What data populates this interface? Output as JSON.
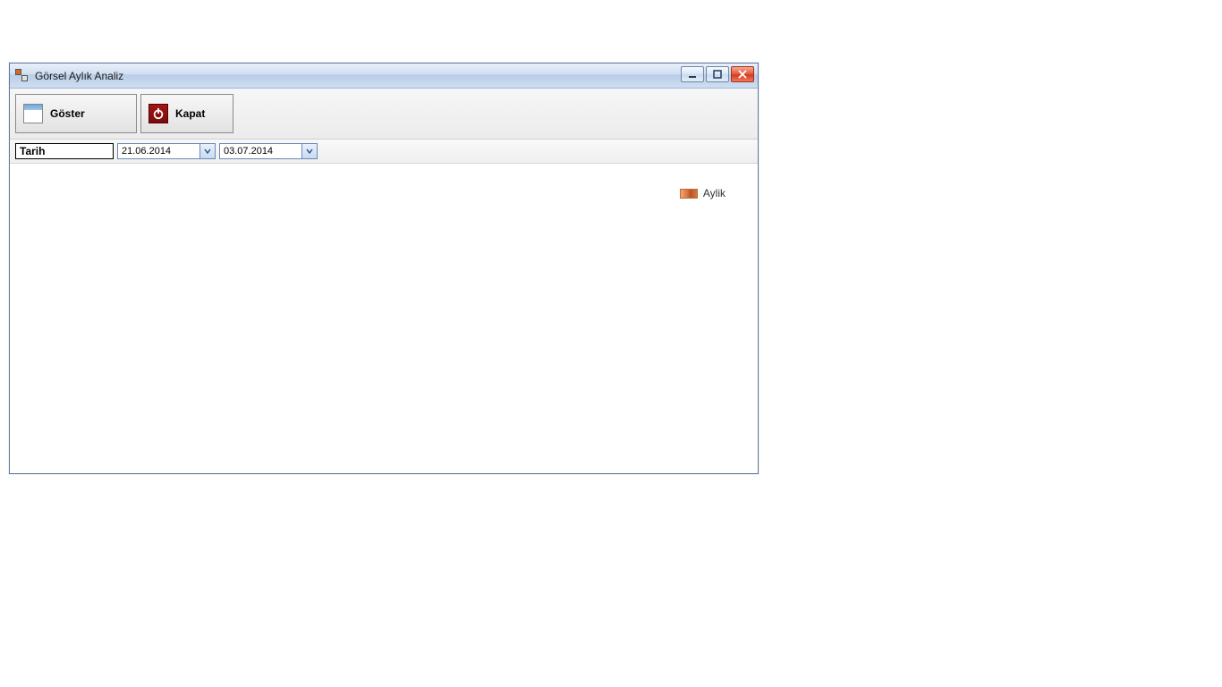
{
  "window": {
    "title": "Görsel Aylık Analiz"
  },
  "toolbar": {
    "show_label": "Göster",
    "close_label": "Kapat"
  },
  "filter": {
    "date_label": "Tarih",
    "date_from": "21.06.2014",
    "date_to": "03.07.2014"
  },
  "legend": {
    "series_label": "Aylik"
  },
  "chart_data": {
    "type": "bar",
    "categories": [],
    "values": [],
    "title": "",
    "xlabel": "",
    "ylabel": "",
    "legend": [
      "Aylik"
    ]
  }
}
